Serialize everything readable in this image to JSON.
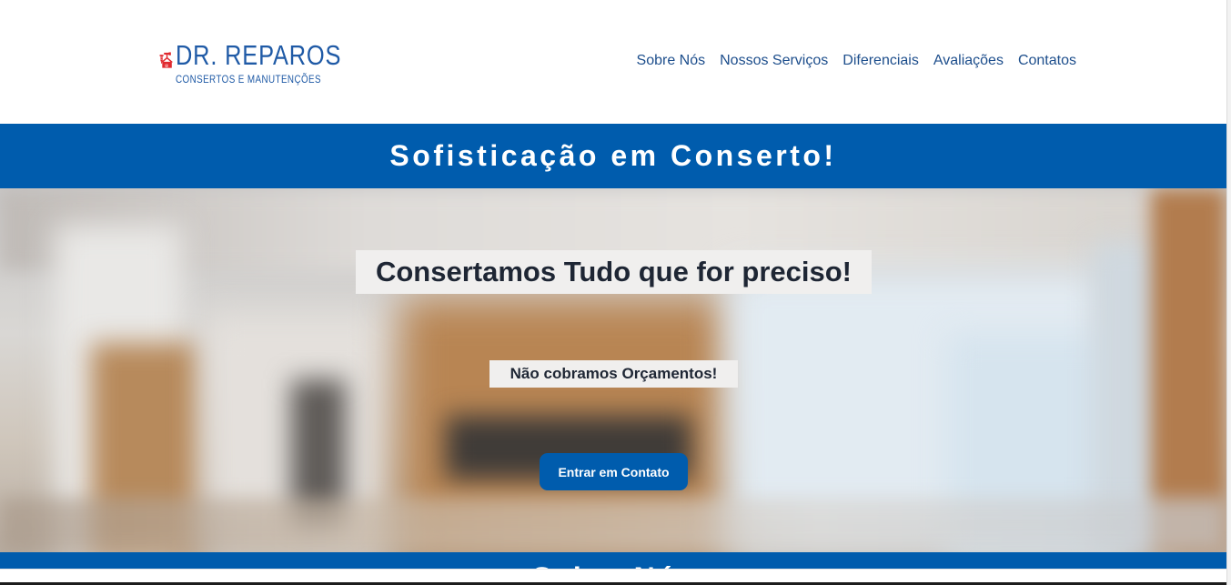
{
  "header": {
    "logo": {
      "title": "DR. REPAROS",
      "subtitle": "CONSERTOS E MANUTENÇÕES"
    },
    "nav": [
      {
        "label": "Sobre Nós"
      },
      {
        "label": "Nossos Serviços"
      },
      {
        "label": "Diferenciais"
      },
      {
        "label": "Avaliações"
      },
      {
        "label": "Contatos"
      }
    ]
  },
  "banner": {
    "title": "Sofisticação em Conserto!"
  },
  "hero": {
    "headline": "Consertamos Tudo que for preciso!",
    "subheadline": "Não cobramos Orçamentos!",
    "cta_label": "Entrar em Contato"
  },
  "next_section": {
    "title_peek": "Sobre Nós"
  },
  "colors": {
    "brand_blue": "#005cad",
    "logo_red": "#e02a2f",
    "logo_blue": "#1f5aa6",
    "nav_text": "#1d4e8c",
    "headline_text": "#1e2634"
  }
}
